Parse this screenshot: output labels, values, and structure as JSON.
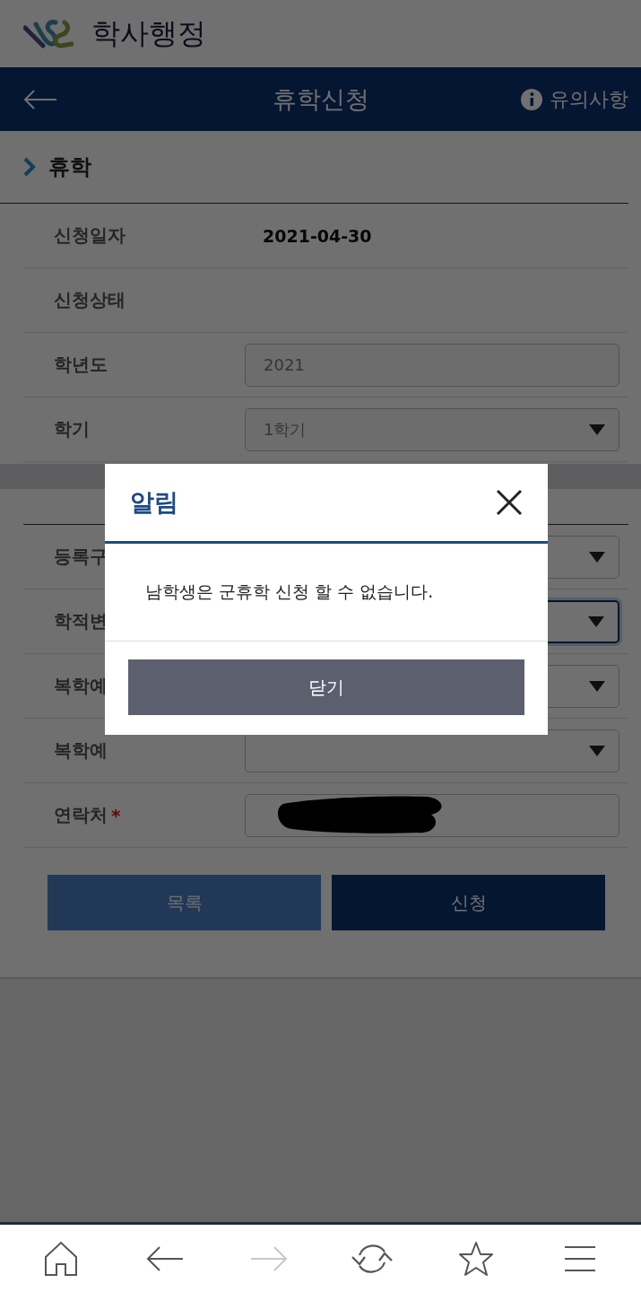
{
  "app_header": {
    "title": "학사행정"
  },
  "nav_bar": {
    "title": "휴학신청",
    "notice_link": "유의사항"
  },
  "section": {
    "title": "휴학",
    "rows": [
      {
        "kind": "text",
        "label": "신청일자",
        "value": "2021-04-30"
      },
      {
        "kind": "text",
        "label": "신청상태"
      },
      {
        "kind": "input",
        "label": "학년도",
        "value": "2021"
      },
      {
        "kind": "select",
        "label": "학기",
        "value": "1학기"
      }
    ]
  },
  "form": {
    "rows": [
      {
        "kind": "select",
        "label": "등록구",
        "focused": false
      },
      {
        "kind": "select",
        "label": "학적변",
        "focused": true
      },
      {
        "kind": "select",
        "label": "복학예",
        "focused": false
      },
      {
        "kind": "select",
        "label": "복학예",
        "focused": false
      },
      {
        "kind": "redacted",
        "label": "연락처",
        "focused": false,
        "required_mark": "*"
      }
    ]
  },
  "buttons": [
    {
      "label": "목록",
      "kind": "secondary"
    },
    {
      "label": "신청",
      "kind": "primary"
    }
  ],
  "dialog": {
    "title": "알림",
    "message": "남학생은 군휴학 신청 할 수 없습니다.",
    "button": "닫기"
  },
  "bottom_bar": [
    {
      "kind": "home",
      "disabled": false
    },
    {
      "kind": "back",
      "disabled": false
    },
    {
      "kind": "forward",
      "disabled": true
    },
    {
      "kind": "refresh",
      "disabled": false
    },
    {
      "kind": "star",
      "disabled": false
    },
    {
      "kind": "menu",
      "disabled": false
    }
  ]
}
